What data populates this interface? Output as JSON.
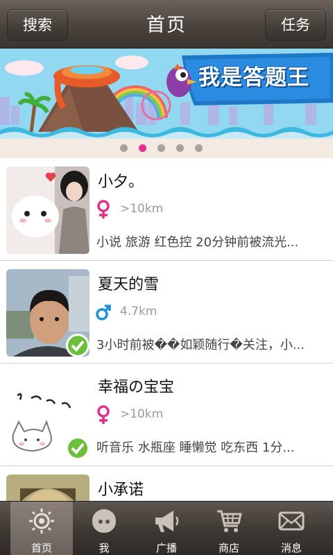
{
  "header": {
    "title": "首页",
    "left_button": "搜索",
    "right_button": "任务"
  },
  "banner": {
    "title": "我是答题王",
    "page_count": 5,
    "active_page": 2
  },
  "list": [
    {
      "name": "小夕。",
      "gender": "female",
      "distance": ">10km",
      "desc": "小说 旅游 红色控 20分钟前被流光...",
      "verified": false,
      "avatar": "girl-with-bunny-photo"
    },
    {
      "name": "夏天的雪",
      "gender": "male",
      "distance": "4.7km",
      "desc": "3小时前被��如颖随行�关注，小...",
      "verified": true,
      "avatar": "young-man-photo"
    },
    {
      "name": "幸福の宝宝",
      "gender": "female",
      "distance": ">10km",
      "desc": "听音乐 水瓶座 睡懒觉 吃东西 1分...",
      "verified": true,
      "avatar": "cartoon-cat-drawing"
    },
    {
      "name": "小承诺",
      "gender": "",
      "distance": "",
      "desc": "",
      "verified": false,
      "avatar": "face-photo"
    }
  ],
  "tabs": [
    {
      "label": "首页",
      "icon": "home-sun-icon",
      "active": true
    },
    {
      "label": "我",
      "icon": "me-face-icon",
      "active": false
    },
    {
      "label": "广播",
      "icon": "megaphone-icon",
      "active": false
    },
    {
      "label": "商店",
      "icon": "shopping-cart-icon",
      "active": false
    },
    {
      "label": "消息",
      "icon": "envelope-icon",
      "active": false
    }
  ],
  "colors": {
    "female": "#e0308c",
    "male": "#1e90d8",
    "verified": "#6cbf3b",
    "header": "#4a433d"
  }
}
